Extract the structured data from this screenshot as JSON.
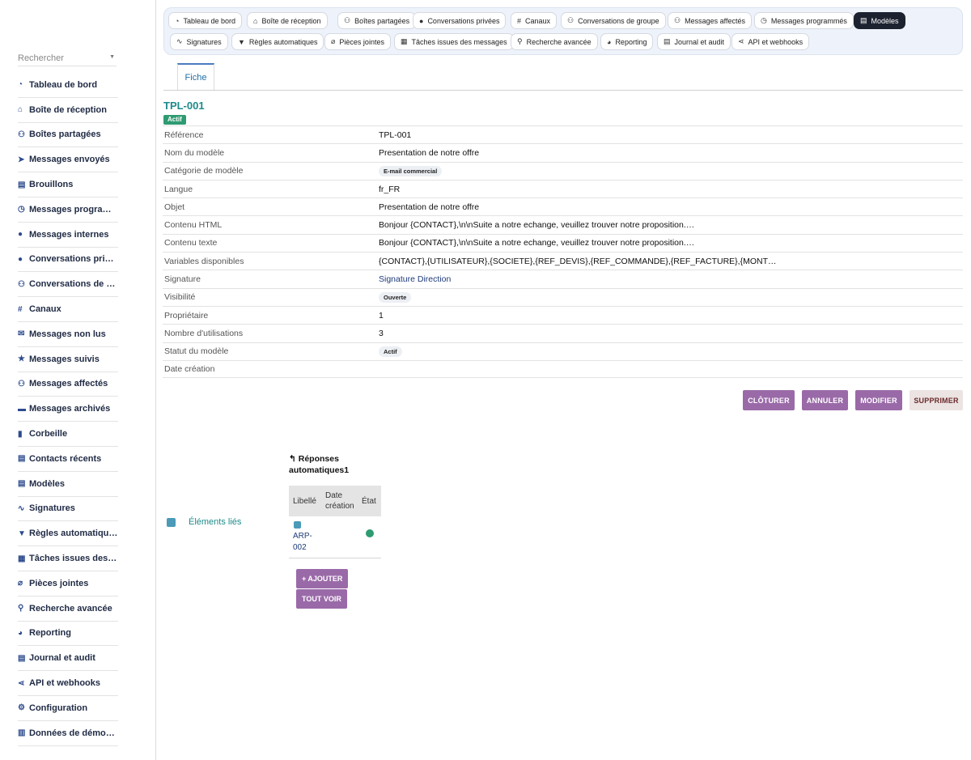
{
  "sidebar": {
    "search_placeholder": "Rechercher",
    "items": [
      {
        "icon": "gauge-icon",
        "glyph": "◔",
        "label": "Tableau de bord"
      },
      {
        "icon": "inbox-icon",
        "glyph": "⌂",
        "label": "Boîte de réception"
      },
      {
        "icon": "users-icon",
        "glyph": "⚇",
        "label": "Boîtes partagées"
      },
      {
        "icon": "paper-plane-icon",
        "glyph": "➤",
        "label": "Messages envoyés"
      },
      {
        "icon": "file-icon",
        "glyph": "▤",
        "label": "Brouillons"
      },
      {
        "icon": "clock-icon",
        "glyph": "◷",
        "label": "Messages programmés"
      },
      {
        "icon": "comment-icon",
        "glyph": "●",
        "label": "Messages internes"
      },
      {
        "icon": "comments-icon",
        "glyph": "●",
        "label": "Conversations privées"
      },
      {
        "icon": "user-group-icon",
        "glyph": "⚇",
        "label": "Conversations de groupe"
      },
      {
        "icon": "hashtag-icon",
        "glyph": "#",
        "label": "Canaux"
      },
      {
        "icon": "envelope-icon",
        "glyph": "✉",
        "label": "Messages non lus"
      },
      {
        "icon": "star-icon",
        "glyph": "★",
        "label": "Messages suivis"
      },
      {
        "icon": "user-check-icon",
        "glyph": "⚇",
        "label": "Messages affectés"
      },
      {
        "icon": "archive-icon",
        "glyph": "▬",
        "label": "Messages archivés"
      },
      {
        "icon": "trash-icon",
        "glyph": "▮",
        "label": "Corbeille"
      },
      {
        "icon": "address-book-icon",
        "glyph": "▤",
        "label": "Contacts récents"
      },
      {
        "icon": "file-template-icon",
        "glyph": "▤",
        "label": "Modèles"
      },
      {
        "icon": "signature-icon",
        "glyph": "∿",
        "label": "Signatures"
      },
      {
        "icon": "filter-icon",
        "glyph": "▼",
        "label": "Règles automatiques"
      },
      {
        "icon": "calendar-check-icon",
        "glyph": "▦",
        "label": "Tâches issues des messages"
      },
      {
        "icon": "paperclip-icon",
        "glyph": "⌀",
        "label": "Pièces jointes"
      },
      {
        "icon": "search-icon",
        "glyph": "⚲",
        "label": "Recherche avancée"
      },
      {
        "icon": "chart-pie-icon",
        "glyph": "◕",
        "label": "Reporting"
      },
      {
        "icon": "book-icon",
        "glyph": "▤",
        "label": "Journal et audit"
      },
      {
        "icon": "share-nodes-icon",
        "glyph": "⋖",
        "label": "API et webhooks"
      },
      {
        "icon": "gear-icon",
        "glyph": "⚙",
        "label": "Configuration"
      },
      {
        "icon": "database-icon",
        "glyph": "▥",
        "label": "Données de démonstration"
      }
    ]
  },
  "topnav": {
    "row1": [
      {
        "icon": "gauge-icon",
        "glyph": "◔",
        "label": "Tableau de bord",
        "active": false
      },
      {
        "icon": "inbox-icon",
        "glyph": "⌂",
        "label": "Boîte de réception",
        "active": false
      },
      {
        "icon": "users-icon",
        "glyph": "⚇",
        "label": "Boîtes partagées",
        "active": false
      },
      {
        "icon": "comments-icon",
        "glyph": "●",
        "label": "Conversations privées",
        "active": false
      },
      {
        "icon": "hashtag-icon",
        "glyph": "#",
        "label": "Canaux",
        "active": false
      },
      {
        "icon": "user-group-icon",
        "glyph": "⚇",
        "label": "Conversations de groupe",
        "active": false
      },
      {
        "icon": "user-check-icon",
        "glyph": "⚇",
        "label": "Messages affectés",
        "active": false
      },
      {
        "icon": "clock-icon",
        "glyph": "◷",
        "label": "Messages programmés",
        "active": false
      },
      {
        "icon": "file-template-icon",
        "glyph": "▤",
        "label": "Modèles",
        "active": true
      }
    ],
    "row2": [
      {
        "icon": "signature-icon",
        "glyph": "∿",
        "label": "Signatures",
        "active": false
      },
      {
        "icon": "filter-icon",
        "glyph": "▼",
        "label": "Règles automatiques",
        "active": false
      },
      {
        "icon": "paperclip-icon",
        "glyph": "⌀",
        "label": "Pièces jointes",
        "active": false
      },
      {
        "icon": "calendar-check-icon",
        "glyph": "▦",
        "label": "Tâches issues des messages",
        "active": false
      },
      {
        "icon": "search-icon",
        "glyph": "⚲",
        "label": "Recherche avancée",
        "active": false
      },
      {
        "icon": "chart-pie-icon",
        "glyph": "◕",
        "label": "Reporting",
        "active": false
      },
      {
        "icon": "book-icon",
        "glyph": "▤",
        "label": "Journal et audit",
        "active": false
      },
      {
        "icon": "share-nodes-icon",
        "glyph": "⋖",
        "label": "API et webhooks",
        "active": false
      }
    ]
  },
  "tabs": {
    "fiche": "Fiche"
  },
  "record": {
    "ref": "TPL-001",
    "status_badge": "Actif",
    "fields": [
      {
        "label": "Référence",
        "value": "TPL-001",
        "type": "text"
      },
      {
        "label": "Nom du modèle",
        "value": "Presentation de notre offre",
        "type": "text"
      },
      {
        "label": "Catégorie de modèle",
        "value": "E-mail commercial",
        "type": "pill"
      },
      {
        "label": "Langue",
        "value": "fr_FR",
        "type": "text"
      },
      {
        "label": "Objet",
        "value": "Presentation de notre offre",
        "type": "text"
      },
      {
        "label": "Contenu HTML",
        "value": "Bonjour {CONTACT},\\n\\nSuite a notre echange, veuillez trouver notre proposition.…",
        "type": "text"
      },
      {
        "label": "Contenu texte",
        "value": "Bonjour {CONTACT},\\n\\nSuite a notre echange, veuillez trouver notre proposition.…",
        "type": "text"
      },
      {
        "label": "Variables disponibles",
        "value": "{CONTACT},{UTILISATEUR},{SOCIETE},{REF_DEVIS},{REF_COMMANDE},{REF_FACTURE},{MONT…",
        "type": "text"
      },
      {
        "label": "Signature",
        "value": "Signature Direction",
        "type": "link"
      },
      {
        "label": "Visibilité",
        "value": "Ouverte",
        "type": "pill"
      },
      {
        "label": "Propriétaire",
        "value": "1",
        "type": "text"
      },
      {
        "label": "Nombre d'utilisations",
        "value": "3",
        "type": "text"
      },
      {
        "label": "Statut du modèle",
        "value": "Actif",
        "type": "pill"
      },
      {
        "label": "Date création",
        "value": "",
        "type": "text"
      }
    ]
  },
  "actions": {
    "close": "CLÔTURER",
    "cancel": "ANNULER",
    "modify": "MODIFIER",
    "delete": "SUPPRIMER"
  },
  "linked": {
    "label": "Éléments liés"
  },
  "auto_replies": {
    "title": "Réponses automatiques1",
    "columns": [
      "Libellé",
      "Date création",
      "État"
    ],
    "rows": [
      {
        "label": "ARP-002",
        "date": "",
        "state": "green"
      }
    ],
    "add": "+ AJOUTER",
    "view_all": "TOUT VOIR"
  }
}
